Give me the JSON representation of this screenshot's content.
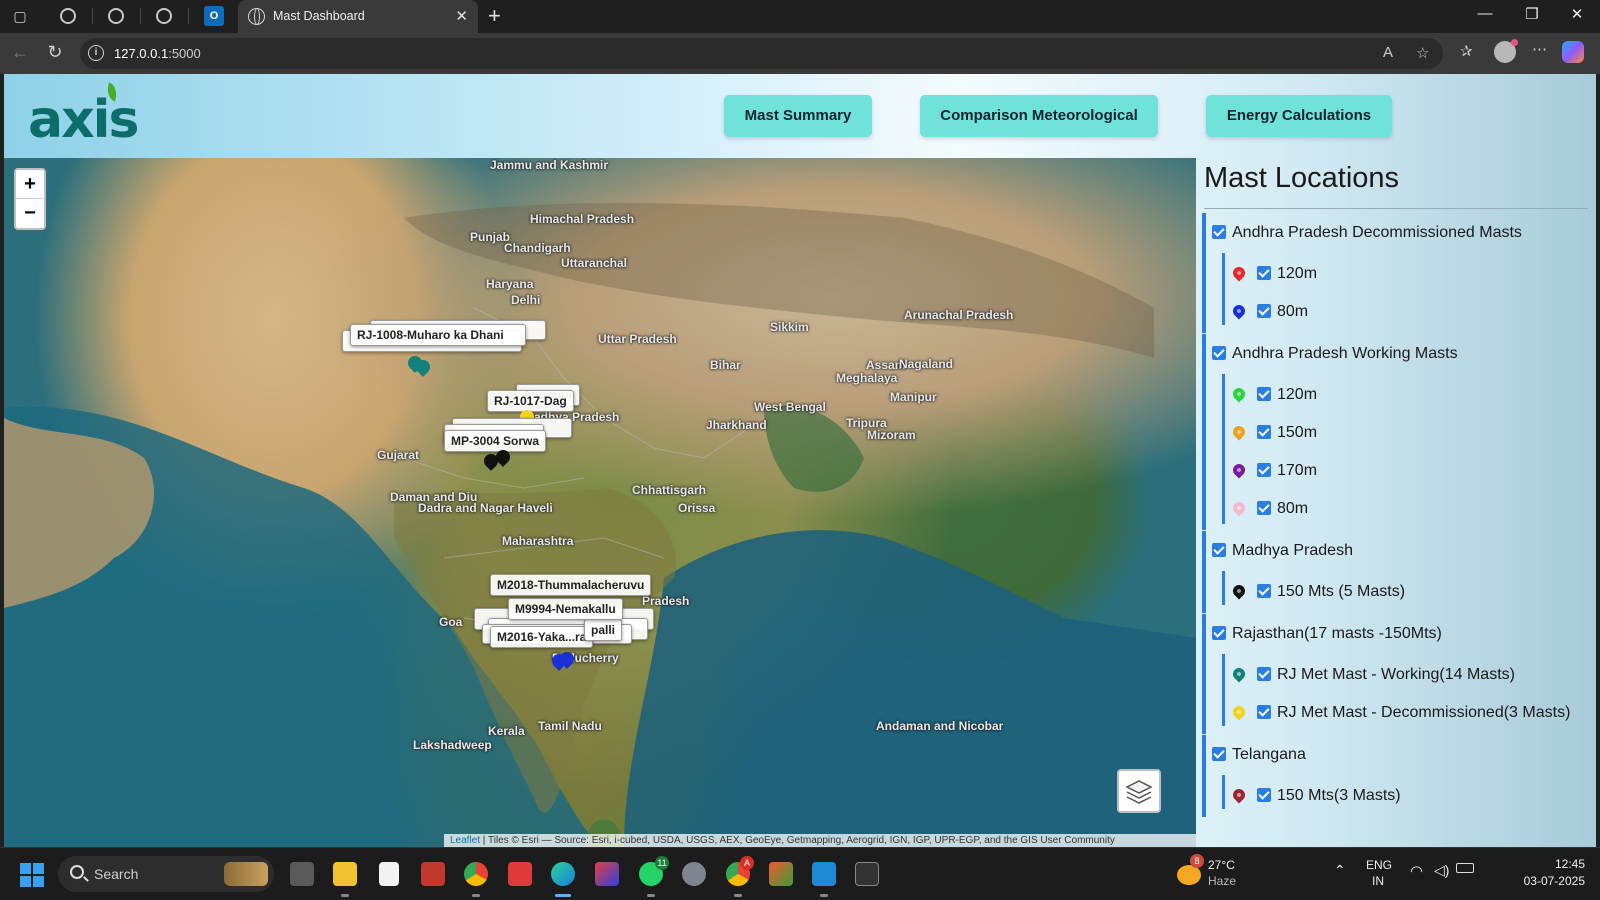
{
  "browser": {
    "active_tab_title": "Mast Dashboard",
    "url_host": "127.0.0.1",
    "url_port": ":5000"
  },
  "header": {
    "logo_text": "axis",
    "nav": [
      "Mast Summary",
      "Comparison Meteorological",
      "Energy Calculations"
    ]
  },
  "map": {
    "zoom_in": "+",
    "zoom_out": "−",
    "place_labels": [
      "Jammu and Kashmir",
      "Himachal Pradesh",
      "Punjab",
      "Chandigarh",
      "Uttaranchal",
      "Haryana",
      "Delhi",
      "Uttar Pradesh",
      "Bihar",
      "Sikkim",
      "Arunachal Pradesh",
      "Assam",
      "Nagaland",
      "Meghalaya",
      "Manipur",
      "West Bengal",
      "Jharkhand",
      "Tripura",
      "Mizoram",
      "Gujarat",
      "Madhya Pradesh",
      "Daman and Diu",
      "Dadra and Nagar Haveli",
      "Chhattisgarh",
      "Orissa",
      "Maharashtra",
      "Goa",
      "Puducherry",
      "Kerala",
      "Tamil Nadu",
      "Lakshadweep",
      "Andaman and Nicobar",
      "Pradesh"
    ],
    "markers": [
      "RJ-1008-Muharo ka Dhani",
      "RJ-1017-Dag",
      "Anuppur",
      "MP-3004 Sorwa",
      "M2018-Thummalacheruvu",
      "M9994-Nemakallu",
      "M2016-Yaka...ra",
      "palli"
    ],
    "attribution_link": "Leaflet",
    "attribution_text": " | Tiles © Esri — Source: Esri, i-cubed, USDA, USGS, AEX, GeoEye, Getmapping, Aerogrid, IGN, IGP, UPR-EGP, and the GIS User Community"
  },
  "panel": {
    "title": "Mast Locations",
    "groups": [
      {
        "label": "Andhra Pradesh Decommissioned Masts",
        "items": [
          {
            "label": "120m",
            "color": "#e8262b"
          },
          {
            "label": "80m",
            "color": "#1b2fd6"
          }
        ]
      },
      {
        "label": "Andhra Pradesh Working Masts",
        "items": [
          {
            "label": "120m",
            "color": "#27d63a"
          },
          {
            "label": "150m",
            "color": "#f0a020"
          },
          {
            "label": "170m",
            "color": "#7a1c9a"
          },
          {
            "label": "80m",
            "color": "#f7b8c9"
          }
        ]
      },
      {
        "label": "Madhya Pradesh",
        "items": [
          {
            "label": "150 Mts (5 Masts)",
            "color": "#111111"
          }
        ]
      },
      {
        "label": "Rajasthan(17 masts -150Mts)",
        "items": [
          {
            "label": "RJ Met Mast - Working(14 Masts)",
            "color": "#14807a"
          },
          {
            "label": "RJ Met Mast - Decommissioned(3 Masts)",
            "color": "#f2d21a"
          }
        ]
      },
      {
        "label": "Telangana",
        "items": [
          {
            "label": "150 Mts(3 Masts)",
            "color": "#9b2630"
          }
        ]
      }
    ]
  },
  "taskbar": {
    "search_label": "Search",
    "weather_temp": "27°C",
    "weather_desc": "Haze",
    "weather_badge": "8",
    "whatsapp_badge": "11",
    "lang_line1": "ENG",
    "lang_line2": "IN",
    "time": "12:45",
    "date": "03-07-2025"
  }
}
